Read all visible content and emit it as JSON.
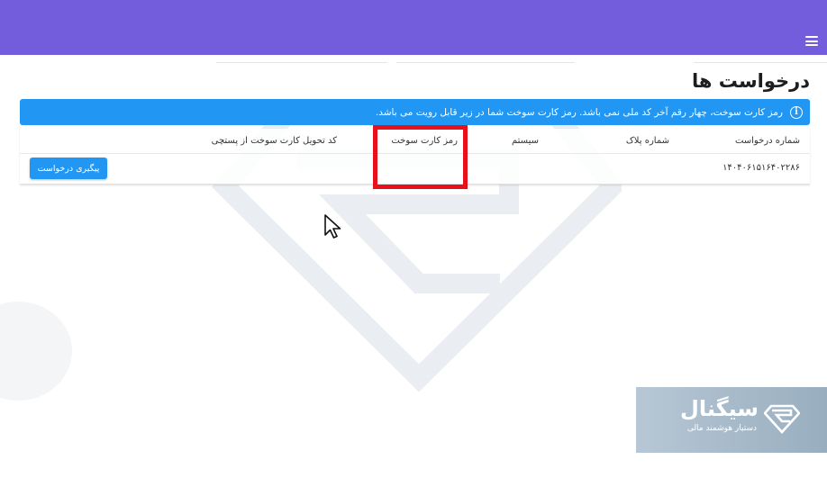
{
  "header": {
    "menu_icon": "hamburger-icon",
    "color": "#735ddc"
  },
  "page": {
    "title": "درخواست ها"
  },
  "alert": {
    "icon": "info-icon",
    "icon_glyph": "i",
    "text": "رمز کارت سوخت، چهار رقم آخر کد ملی نمی باشد. رمز کارت سوخت شما در زیر قابل رویت می باشد.",
    "color": "#2196f3"
  },
  "table": {
    "columns": [
      "شماره درخواست",
      "شماره پلاک",
      "سیستم",
      "رمز کارت سوخت",
      "کد تحویل کارت سوخت از پستچی"
    ],
    "rows": [
      {
        "request_number": "۱۴۰۴۰۶۱۵۱۶۴۰۲۲۸۶",
        "plate_number": "",
        "system": "",
        "fuel_card_pin": "",
        "delivery_code": "",
        "action_label": "پیگیری درخواست"
      }
    ]
  },
  "annotation": {
    "highlight_color": "#e8101a"
  },
  "brand": {
    "name": "سیگنال",
    "tagline": "دستیار هوشمند مالی",
    "logo_icon": "signal-logo-icon"
  }
}
